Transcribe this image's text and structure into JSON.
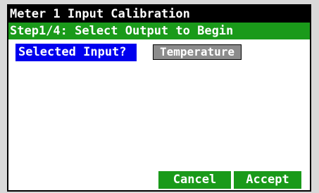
{
  "header": {
    "title": "Meter 1 Input Calibration",
    "step": "Step1/4: Select Output to Begin"
  },
  "form": {
    "prompt_label": "Selected Input?",
    "selected_value": "Temperature"
  },
  "footer": {
    "cancel_label": "Cancel",
    "accept_label": "Accept"
  },
  "colors": {
    "title_background": "#000000",
    "step_background": "#1a9a1a",
    "prompt_background": "#0000ee",
    "field_background": "#8c8c8c",
    "button_background": "#1a9a1a"
  }
}
